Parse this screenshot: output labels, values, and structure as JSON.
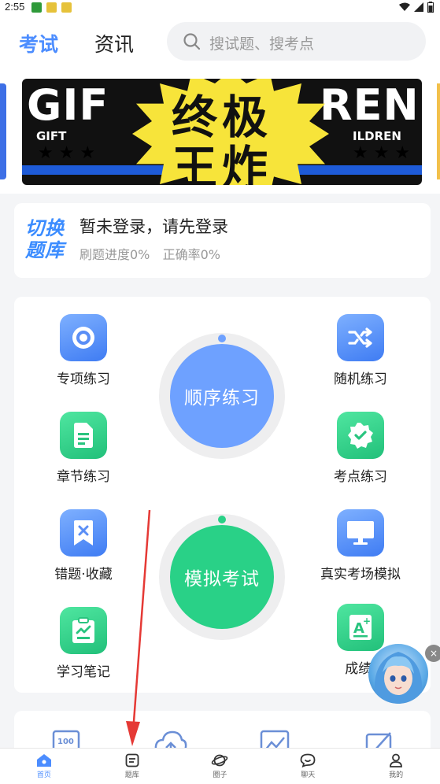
{
  "status_bar": {
    "time": "2:55"
  },
  "header": {
    "tabs": [
      {
        "label": "考试",
        "active": true
      },
      {
        "label": "资讯",
        "active": false
      }
    ],
    "search_placeholder": "搜试题、搜考点"
  },
  "banner": {
    "headline": [
      "终极",
      "王炸"
    ],
    "bg_words": [
      "GIF",
      "REN"
    ],
    "small_words": [
      "GIFT",
      "ILDREN"
    ],
    "accent": "#f7e43a"
  },
  "login": {
    "switch_label": "切换题库",
    "title": "暂未登录，请先登录",
    "progress_text": "刷题进度0%",
    "accuracy_text": "正确率0%"
  },
  "features": {
    "special": "专项练习",
    "random": "随机练习",
    "chapter": "章节练习",
    "keypoint": "考点练习",
    "mistakes": "错题·收藏",
    "real_mock": "真实考场模拟",
    "notes": "学习笔记",
    "scores": "成绩·",
    "sequential": "顺序练习",
    "mock_exam": "模拟考试"
  },
  "colors": {
    "primary": "#4c8dff",
    "green": "#29d187",
    "blue_ring": "#6ea1ff"
  },
  "nav": [
    {
      "label": "首页",
      "icon": "home-icon",
      "active": true
    },
    {
      "label": "题库",
      "icon": "question-bank-icon",
      "active": false
    },
    {
      "label": "圈子",
      "icon": "planet-icon",
      "active": false
    },
    {
      "label": "聊天",
      "icon": "chat-icon",
      "active": false
    },
    {
      "label": "我的",
      "icon": "profile-icon",
      "active": false
    }
  ]
}
